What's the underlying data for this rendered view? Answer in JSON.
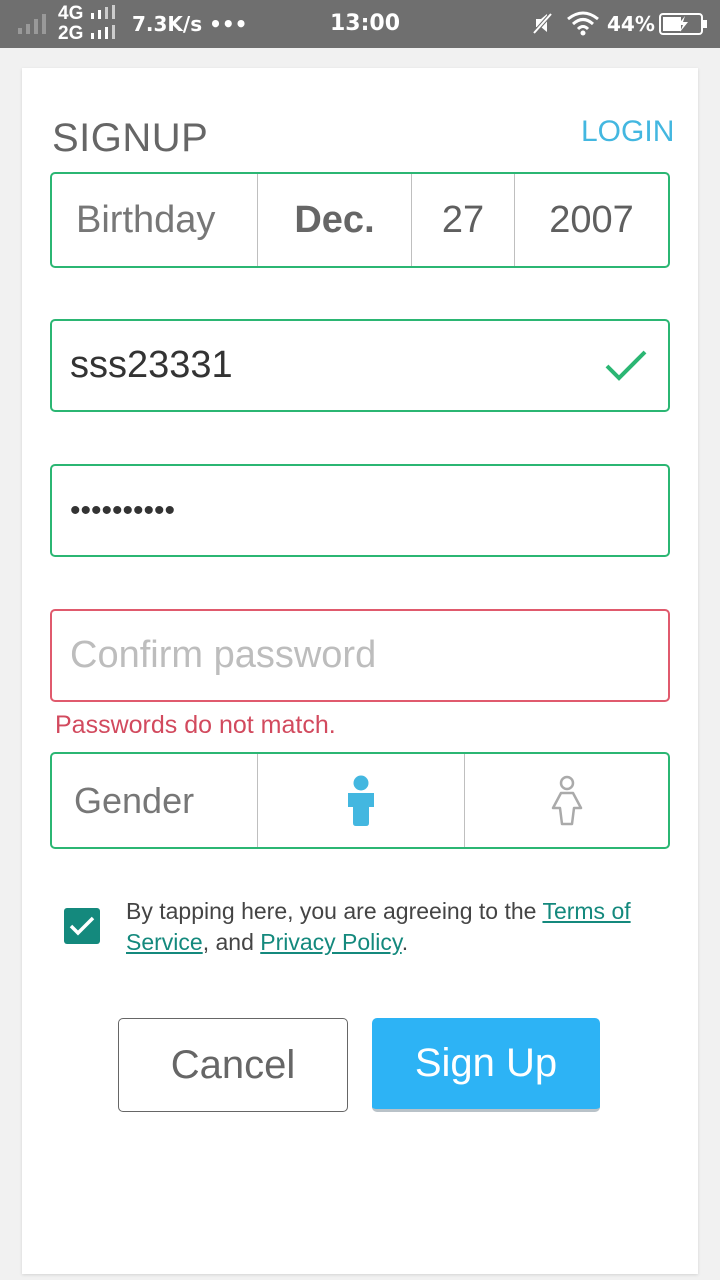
{
  "status_bar": {
    "network_top": "4G",
    "network_bottom": "2G",
    "speed": "7.3K/s",
    "dots": "•••",
    "time": "13:00",
    "battery": "44%"
  },
  "header": {
    "title": "SIGNUP",
    "login_link": "LOGIN"
  },
  "birthday": {
    "label": "Birthday",
    "month": "Dec.",
    "day": "27",
    "year": "2007"
  },
  "username": {
    "value": "sss23331",
    "valid_icon": "check-icon"
  },
  "password": {
    "value": "••••••••••"
  },
  "confirm_password": {
    "placeholder": "Confirm password",
    "error": "Passwords do not match."
  },
  "gender": {
    "label": "Gender",
    "options": [
      {
        "icon": "male-person-icon",
        "selected": true
      },
      {
        "icon": "female-person-icon",
        "selected": false
      }
    ]
  },
  "terms": {
    "checked": true,
    "prefix": "By tapping here, you are agreeing to the ",
    "tos_link": "Terms of Service",
    "middle": ", and ",
    "privacy_link": "Privacy Policy",
    "suffix": "."
  },
  "buttons": {
    "cancel": "Cancel",
    "signup": "Sign Up"
  },
  "colors": {
    "accent_green": "#2bb673",
    "error_red": "#e05a6d",
    "link_blue": "#43b7e0",
    "primary_blue": "#2db3f5",
    "teal": "#14897d"
  }
}
